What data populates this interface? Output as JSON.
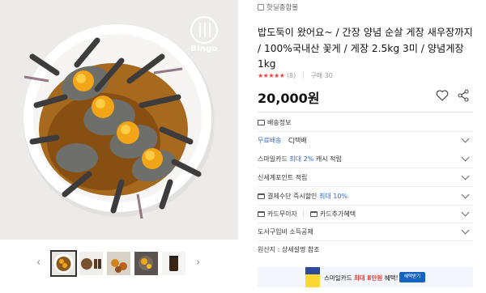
{
  "store": {
    "name": "핫딜종합몰"
  },
  "product": {
    "title": "밥도둑이 왔어요~ / 간장 양념 순살 게장 새우장까지 / 100%국내산 꽃게 / 게장 2.5kg 3미 / 양념게장 1kg",
    "rating_stars": "★★★★★",
    "rating_count": "(8)",
    "purchase_count": "구매 30",
    "price": "20,000원"
  },
  "logo": {
    "text": "Bingo"
  },
  "delivery": {
    "header": "배송정보",
    "type": "무료배송",
    "carrier": "CJ택배"
  },
  "benefits": {
    "smile_card_prefix": "스마일카드",
    "smile_card_highlight": "최대 2%",
    "smile_card_suffix": "캐시 적립",
    "shinsegae": "신세계포인트 적립",
    "instant_prefix": "결제수단 즉시할인",
    "instant_highlight": "최대 10%",
    "interest_free": "카드무이자",
    "card_extra": "카드추가혜택",
    "book_deduction": "도서구입비 소득공제",
    "origin": "원산지 : 상세설명 참조"
  },
  "banner": {
    "text_prefix": "스마일카드",
    "text_highlight": "최대 8만원",
    "text_suffix": "혜택!",
    "button": "혜택받기"
  },
  "colors": {
    "accent_blue": "#2e67d9",
    "star_red": "#f1413e",
    "banner_btn": "#1565c0"
  }
}
